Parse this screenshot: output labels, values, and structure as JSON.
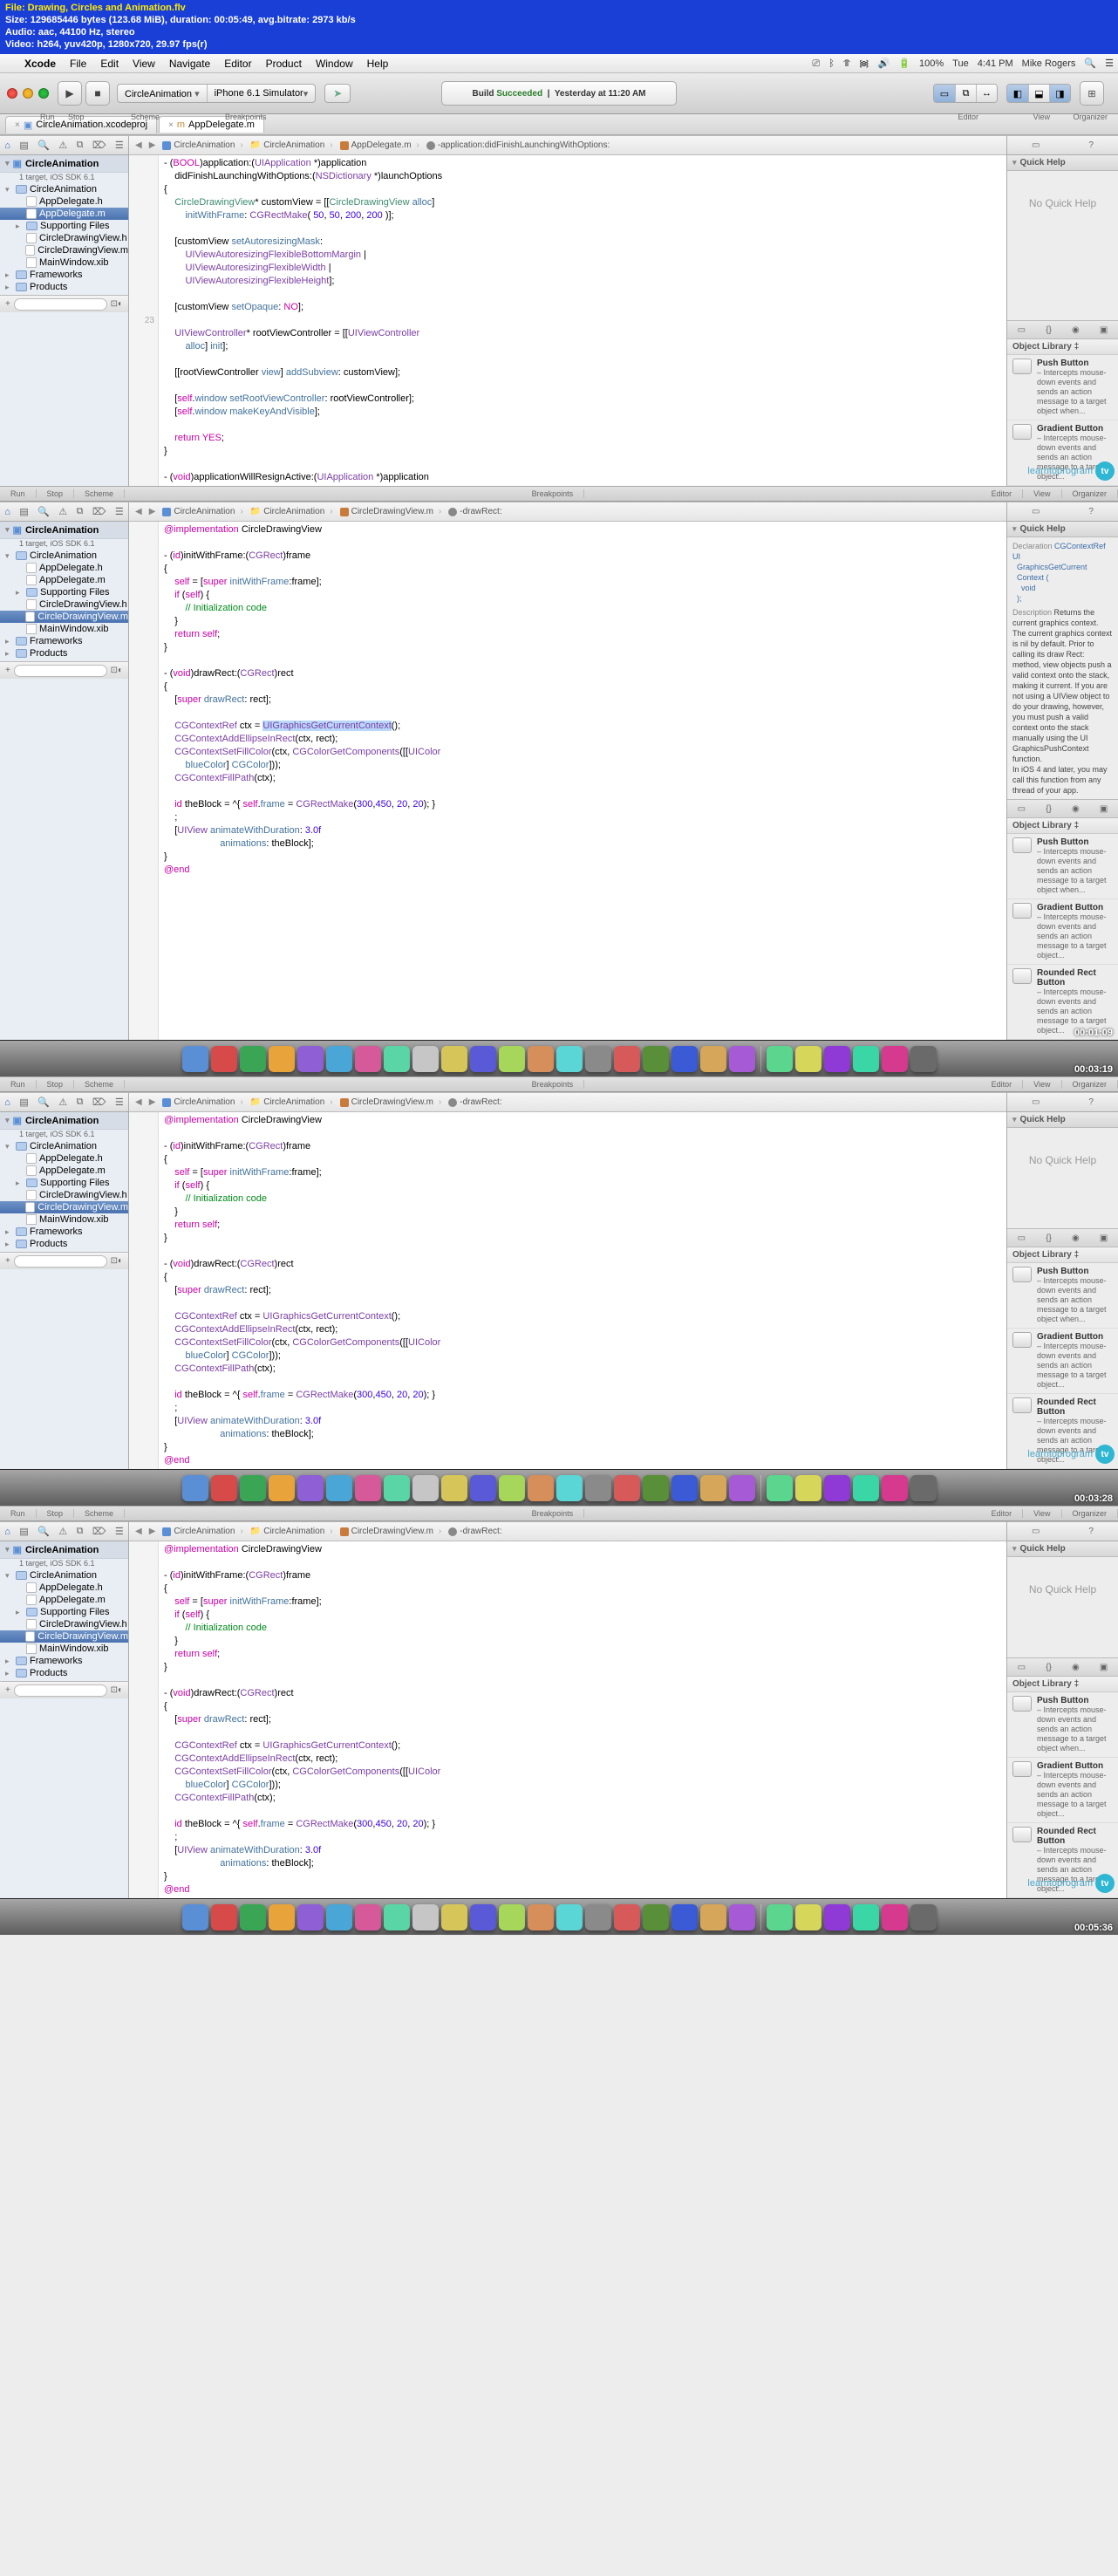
{
  "info_banner": {
    "file": "File: Drawing, Circles and Animation.flv",
    "size": "Size: 129685446 bytes (123.68 MiB), duration: 00:05:49, avg.bitrate: 2973 kb/s",
    "audio": "Audio: aac, 44100 Hz, stereo",
    "video": "Video: h264, yuv420p, 1280x720, 29.97 fps(r)"
  },
  "menubar": {
    "app": "Xcode",
    "items": [
      "File",
      "Edit",
      "View",
      "Navigate",
      "Editor",
      "Product",
      "Window",
      "Help"
    ],
    "status": {
      "wifi": "⏚",
      "bt": "⌥",
      "vol": "🔊",
      "batt": "100%",
      "day": "Tue",
      "time": "4:41 PM",
      "user": "Mike Rogers"
    }
  },
  "toolbar": {
    "scheme_app": "CircleAnimation",
    "scheme_dest": "iPhone 6.1 Simulator",
    "activity_l1a": "Build ",
    "activity_l1b": "Succeeded",
    "activity_l2": "Yesterday at 11:20 AM",
    "labels": {
      "run": "Run",
      "stop": "Stop",
      "scheme": "Scheme",
      "bp": "Breakpoints",
      "editor": "Editor",
      "view": "View",
      "org": "Organizer"
    }
  },
  "tabs": {
    "t1": "CircleAnimation.xcodeproj",
    "t2": "AppDelegate.m"
  },
  "navigator": {
    "project": "CircleAnimation",
    "target_sub": "1 target, iOS SDK 6.1",
    "tree_top": [
      {
        "l": 0,
        "d": "open",
        "k": "folder",
        "n": "CircleAnimation"
      },
      {
        "l": 1,
        "d": "",
        "k": "h",
        "n": "AppDelegate.h"
      },
      {
        "l": 1,
        "d": "",
        "k": "m",
        "n": "AppDelegate.m",
        "sel": true
      },
      {
        "l": 1,
        "d": "closed",
        "k": "folder",
        "n": "Supporting Files"
      },
      {
        "l": 1,
        "d": "",
        "k": "h",
        "n": "CircleDrawingView.h"
      },
      {
        "l": 1,
        "d": "",
        "k": "m",
        "n": "CircleDrawingView.m"
      },
      {
        "l": 1,
        "d": "",
        "k": "xib",
        "n": "MainWindow.xib"
      },
      {
        "l": 0,
        "d": "closed",
        "k": "folder",
        "n": "Frameworks"
      },
      {
        "l": 0,
        "d": "closed",
        "k": "folder",
        "n": "Products"
      }
    ],
    "tree_cdv": [
      {
        "l": 0,
        "d": "open",
        "k": "folder",
        "n": "CircleAnimation"
      },
      {
        "l": 1,
        "d": "",
        "k": "h",
        "n": "AppDelegate.h"
      },
      {
        "l": 1,
        "d": "",
        "k": "m",
        "n": "AppDelegate.m"
      },
      {
        "l": 1,
        "d": "closed",
        "k": "folder",
        "n": "Supporting Files"
      },
      {
        "l": 1,
        "d": "",
        "k": "h",
        "n": "CircleDrawingView.h"
      },
      {
        "l": 1,
        "d": "",
        "k": "m",
        "n": "CircleDrawingView.m",
        "sel": true
      },
      {
        "l": 1,
        "d": "",
        "k": "xib",
        "n": "MainWindow.xib"
      },
      {
        "l": 0,
        "d": "closed",
        "k": "folder",
        "n": "Frameworks"
      },
      {
        "l": 0,
        "d": "closed",
        "k": "folder",
        "n": "Products"
      }
    ]
  },
  "jumpbar_top": [
    "CircleAnimation",
    "CircleAnimation",
    "AppDelegate.m",
    "-application:didFinishLaunchingWithOptions:"
  ],
  "jumpbar_cdv": [
    "CircleAnimation",
    "CircleAnimation",
    "CircleDrawingView.m",
    "-drawRect:"
  ],
  "quickhelp": {
    "title": "Quick Help",
    "none": "No Quick Help",
    "decl_lbl": "Declaration",
    "decl": "CGContextRef UI\n  GraphicsGetCurrent\n  Context (\n    void\n  );",
    "desc_lbl": "Description",
    "desc": "Returns the current graphics context.\nThe current graphics context is nil by default. Prior to calling its draw Rect: method, view objects push a valid context onto the stack, making it current. If you are not using a UIView object to do your drawing, however, you must push a valid context onto the stack manually using the UI GraphicsPushContext function.\nIn iOS 4 and later, you may call this function from any thread of your app."
  },
  "object_library": {
    "title": "Object Library",
    "items": [
      {
        "n": "Push Button",
        "d": "– Intercepts mouse-down events and sends an action message to a target object when..."
      },
      {
        "n": "Gradient Button",
        "d": "– Intercepts mouse-down events and sends an action message to a target object..."
      },
      {
        "n": "Rounded Rect Button",
        "d": "– Intercepts mouse-down events and sends an action message to a target object..."
      }
    ]
  },
  "code_appdelegate": "- (<kw>BOOL</kw>)application:(<ty>UIApplication</ty> *)application\n    didFinishLaunchingWithOptions:(<ty>NSDictionary</ty> *)launchOptions\n{\n    <usr>CircleDrawingView</usr>* customView = [[<usr>CircleDrawingView</usr> <msg>alloc</msg>]\n        <msg>initWithFrame</msg>: <ty>CGRectMake</ty>( <num>50</num>, <num>50</num>, <num>200</num>, <num>200</num> )];\n\n    [customView <msg>setAutoresizingMask</msg>:\n        <ty>UIViewAutoresizingFlexibleBottomMargin</ty> |\n        <ty>UIViewAutoresizingFlexibleWidth</ty> |\n        <ty>UIViewAutoresizingFlexibleHeight</ty>];\n\n    [customView <msg>setOpaque</msg>: <kw>NO</kw>];\n\n    <ty>UIViewController</ty>* rootViewController = [[<ty>UIViewController</ty>\n        <msg>alloc</msg>] <msg>init</msg>];\n\n    [[rootViewController <msg>view</msg>] <msg>addSubview</msg>: customView];\n\n    [<kw>self</kw>.<msg>window</msg> <msg>setRootViewController</msg>: rootViewController];\n    [<kw>self</kw>.<msg>window</msg> <msg>makeKeyAndVisible</msg>];\n\n    <kw>return</kw> <kw>YES</kw>;\n}\n\n- (<kw>void</kw>)applicationWillResignActive:(<ty>UIApplication</ty> *)application",
  "code_cdv_hl": "<kw>@implementation</kw> CircleDrawingView\n\n- (<kw>id</kw>)initWithFrame:(<ty>CGRect</ty>)frame\n{\n    <kw>self</kw> = [<kw>super</kw> <msg>initWithFrame</msg>:frame];\n    <kw>if</kw> (<kw>self</kw>) {\n        <cm>// Initialization code</cm>\n    }\n    <kw>return</kw> <kw>self</kw>;\n}\n\n- (<kw>void</kw>)drawRect:(<ty>CGRect</ty>)rect\n{\n    [<kw>super</kw> <msg>drawRect</msg>: rect];\n\n    <ty>CGContextRef</ty> ctx = <span class=sel-span><ty>UIGraphicsGetCurrentContext</ty></span>();\n    <ty>CGContextAddEllipseInRect</ty>(ctx, rect);\n    <ty>CGContextSetFillColor</ty>(ctx, <ty>CGColorGetComponents</ty>([[<ty>UIColor</ty>\n        <msg>blueColor</msg>] <msg>CGColor</msg>]));\n    <ty>CGContextFillPath</ty>(ctx);\n\n    <kw>id</kw> theBlock = ^{ <kw>self</kw>.<msg>frame</msg> = <ty>CGRectMake</ty>(<num>300</num>,<num>450</num>, <num>20</num>, <num>20</num>); }\n    ;\n    [<ty>UIView</ty> <msg>animateWithDuration</msg>: <num>3.0f</num>\n                     <msg>animations</msg>: theBlock];\n}\n<kw>@end</kw>",
  "code_cdv_plain": "<kw>@implementation</kw> CircleDrawingView\n\n- (<kw>id</kw>)initWithFrame:(<ty>CGRect</ty>)frame\n{\n    <kw>self</kw> = [<kw>super</kw> <msg>initWithFrame</msg>:frame];\n    <kw>if</kw> (<kw>self</kw>) {\n        <cm>// Initialization code</cm>\n    }\n    <kw>return</kw> <kw>self</kw>;\n}\n\n- (<kw>void</kw>)drawRect:(<ty>CGRect</ty>)rect\n{\n    [<kw>super</kw> <msg>drawRect</msg>: rect];\n\n    <ty>CGContextRef</ty> ctx = <ty>UIGraphicsGetCurrentContext</ty>();\n    <ty>CGContextAddEllipseInRect</ty>(ctx, rect);\n    <ty>CGContextSetFillColor</ty>(ctx, <ty>CGColorGetComponents</ty>([[<ty>UIColor</ty>\n        <msg>blueColor</msg>] <msg>CGColor</msg>]));\n    <ty>CGContextFillPath</ty>(ctx);\n\n    <kw>id</kw> theBlock = ^{ <kw>self</kw>.<msg>frame</msg> = <ty>CGRectMake</ty>(<num>300</num>,<num>450</num>, <num>20</num>, <num>20</num>); }\n    ;\n    [<ty>UIView</ty> <msg>animateWithDuration</msg>: <num>3.0f</num>\n                     <msg>animations</msg>: theBlock];\n}\n<kw>@end</kw>",
  "watermark": "learntoprogram",
  "timestamps": [
    "00:01:09",
    "00:03:19",
    "00:03:28",
    "00:05:36"
  ],
  "dock_colors": [
    "#5a8fd6",
    "#d64a4a",
    "#3aa655",
    "#e8a33a",
    "#8f5fd6",
    "#4aa6d6",
    "#d65a9a",
    "#5ad6a6",
    "#c6c6c6",
    "#d6c65a",
    "#5a5ad6",
    "#a6d65a",
    "#d68f5a",
    "#5ad6d6",
    "#8a8a8a",
    "#d65a5a",
    "#5a8f3a",
    "#3a5ad6",
    "#d6a65a",
    "#a65ad6",
    "#5ad68f",
    "#d6d65a",
    "#8f3ad6",
    "#3ad6a6",
    "#d63a8f",
    "#6a6a6a"
  ]
}
